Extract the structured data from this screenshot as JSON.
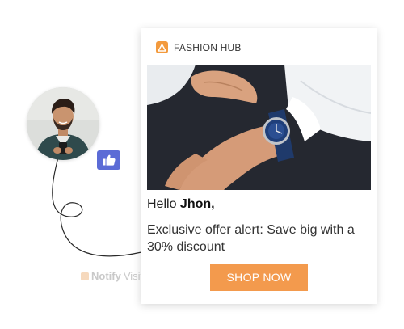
{
  "brand": {
    "name": "FASHION HUB",
    "accent": "#f39a3d",
    "logo_icon": "warning-triangle-icon"
  },
  "notification": {
    "greeting": "Hello",
    "user_name": "Jhon,",
    "message": "Exclusive offer alert: Save big with a 30% discount",
    "cta_label": "SHOP NOW",
    "cta_color": "#f39a4d",
    "hero_image": "man adjusting wristwatch"
  },
  "user": {
    "avatar": "smiling man holding phone",
    "reaction_icon": "thumbs-up-icon",
    "reaction_color": "#5b6bd6"
  },
  "watermark": {
    "bold": "Notify",
    "regular": "Visitors"
  }
}
